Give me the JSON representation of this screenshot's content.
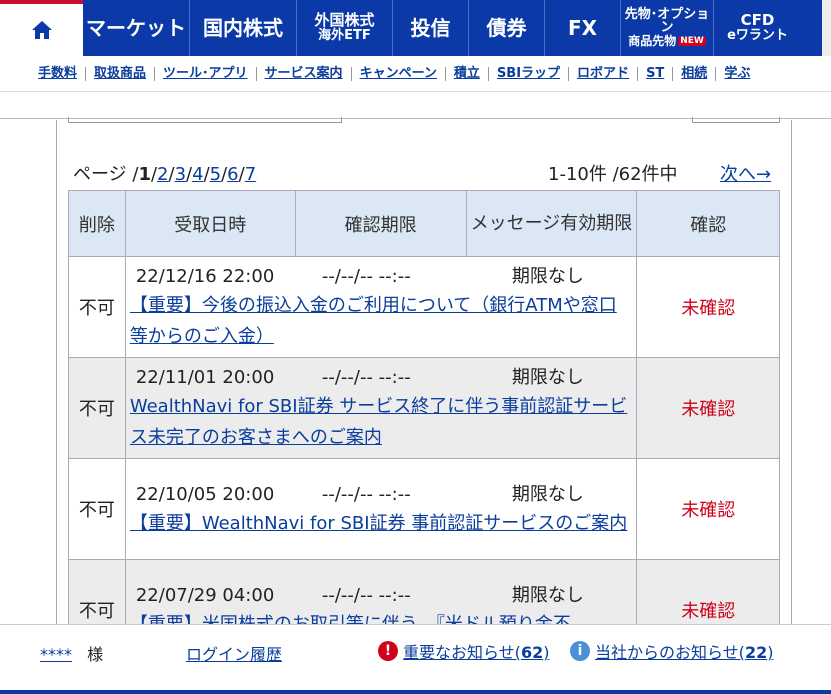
{
  "topnav": {
    "items": [
      {
        "label": "マーケット"
      },
      {
        "label": "国内株式"
      },
      {
        "label": "外国株式",
        "sub": "海外ETF"
      },
      {
        "label": "投信"
      },
      {
        "label": "債券"
      },
      {
        "label": "FX"
      },
      {
        "label": "先物･オプション",
        "sub": "商品先物",
        "badge": "NEW"
      },
      {
        "label": "CFD",
        "sub": "eワラント"
      }
    ]
  },
  "subnav": [
    "手数料",
    "取扱商品",
    "ツール･アプリ",
    "サービス案内",
    "キャンペーン",
    "積立",
    "SBIラップ",
    "ロボアド",
    "ST",
    "相続",
    "学ぶ"
  ],
  "pager": {
    "prefix": "ページ /",
    "current": "1",
    "pages": [
      "2",
      "3",
      "4",
      "5",
      "6",
      "7"
    ],
    "count": "1-10件 /62件中",
    "next": "次へ→"
  },
  "table": {
    "headers": [
      "削除",
      "受取日時",
      "確認期限",
      "メッセージ有効期限",
      "確認"
    ],
    "rows": [
      {
        "del": "不可",
        "received": "22/12/16 22:00",
        "deadline": "--/--/-- --:--",
        "validity": "期限なし",
        "subject": "【重要】今後の振込入金のご利用について（銀行ATMや窓口等からのご入金）",
        "status": "未確認"
      },
      {
        "del": "不可",
        "received": "22/11/01 20:00",
        "deadline": "--/--/-- --:--",
        "validity": "期限なし",
        "subject": "WealthNavi for SBI証券 サービス終了に伴う事前認証サービス未完了のお客さまへのご案内",
        "status": "未確認"
      },
      {
        "del": "不可",
        "received": "22/10/05 20:00",
        "deadline": "--/--/-- --:--",
        "validity": "期限なし",
        "subject": "【重要】WealthNavi for SBI証券 事前認証サービスのご案内",
        "status": "未確認"
      },
      {
        "del": "不可",
        "received": "22/07/29 04:00",
        "deadline": "--/--/-- --:--",
        "validity": "期限なし",
        "subject": "【重要】米国株式のお取引等に伴う、『米ドル預り金不",
        "status": "未確認"
      }
    ]
  },
  "footer": {
    "user": "****",
    "sama": "様",
    "history": "ログイン履歴",
    "important": "重要なお知らせ(",
    "important_count": "62",
    "notice": "当社からのお知らせ(",
    "notice_count": "22"
  },
  "colors": {
    "nav": "#0b3aa8",
    "accent": "#c8102e",
    "unread": "#d0021b",
    "header_bg": "#dbe7f5"
  }
}
